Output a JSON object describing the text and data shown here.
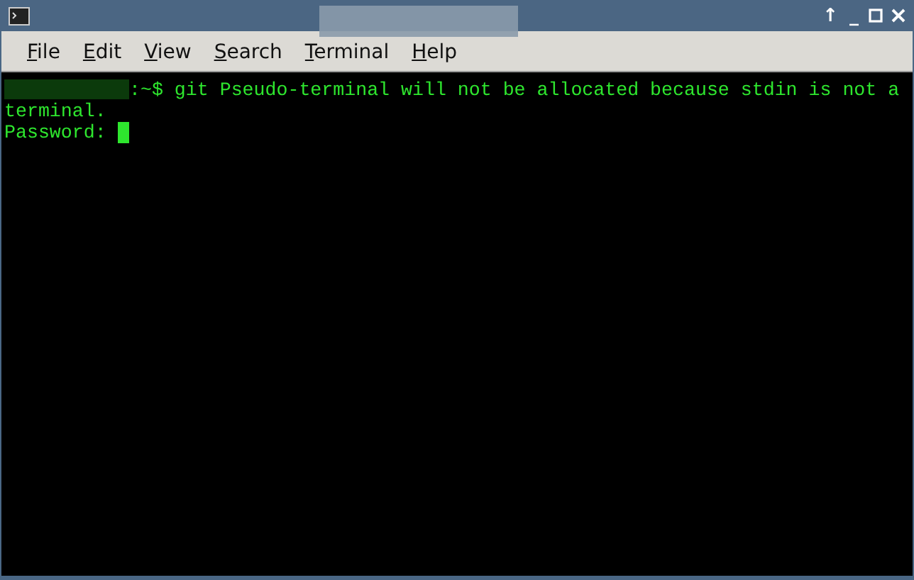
{
  "window": {
    "controls": [
      "↑",
      "_"
    ]
  },
  "menu": [
    {
      "label": "File"
    },
    {
      "label": "Edit"
    },
    {
      "label": "View"
    },
    {
      "label": "Search"
    },
    {
      "label": "Terminal"
    },
    {
      "label": "Help"
    }
  ],
  "terminal": {
    "lines": [
      {
        "kind": "prompt",
        "text": ":~$ git Pseudo-terminal will not be allocated because stdin is not a"
      },
      {
        "kind": "output",
        "text": "terminal."
      },
      {
        "kind": "input",
        "text": "Password: "
      }
    ]
  }
}
